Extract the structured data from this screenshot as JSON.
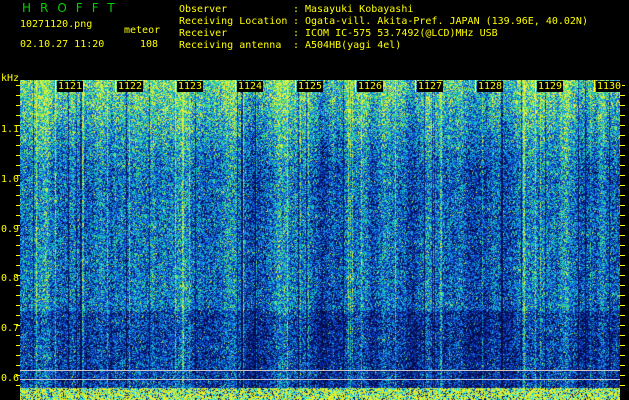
{
  "header": {
    "app_title": "HROFFT",
    "filename": "10271120.png",
    "meteor_label": "meteor",
    "datetime": "02.10.27 11:20",
    "meteor_count": "108"
  },
  "info": [
    {
      "key": "Observer",
      "value": "Masayuki Kobayashi"
    },
    {
      "key": "Receiving Location",
      "value": "Ogata-vill. Akita-Pref. JAPAN (139.96E, 40.02N)"
    },
    {
      "key": "Receiver",
      "value": "ICOM IC-575 53.7492(@LCD)MHz USB"
    },
    {
      "key": "Receiving antenna",
      "value": "A504HB(yagi 4el)"
    }
  ],
  "separator": ":",
  "axis": {
    "unit_label": "kHz",
    "y_labels": [
      "1.1",
      "1.0",
      "0.9",
      "0.8",
      "0.7",
      "0.6"
    ],
    "time_labels": [
      "1121",
      "1122",
      "1123",
      "1124",
      "1125",
      "1126",
      "1127",
      "1128",
      "1129",
      "1130"
    ]
  },
  "colors": {
    "text": "#ffff00",
    "title": "#00d000",
    "background": "#000000",
    "spectrum_low": "#0a1e8c",
    "spectrum_high": "#00ffa0"
  }
}
